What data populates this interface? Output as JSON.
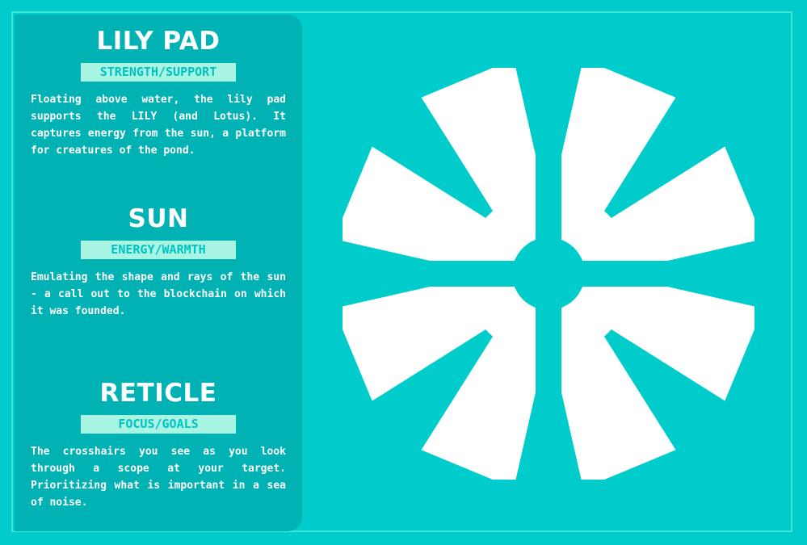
{
  "sections": [
    {
      "title": "LILY PAD",
      "tag": "STRENGTH/SUPPORT",
      "body": "Floating above water, the lily pad supports the LILY (and Lotus). It captures energy from the sun, a platform for creatures of the pond."
    },
    {
      "title": "SUN",
      "tag": "ENERGY/WARMTH",
      "body": "Emulating the shape and rays of the sun - a call out to the blockchain on which it was founded."
    },
    {
      "title": "RETICLE",
      "tag": "FOCUS/GOALS",
      "body": "The crosshairs you see as you look through a scope at your target. Prioritizing what is important in a sea of noise."
    }
  ],
  "emblem": {
    "icon": "sun-reticle-logo-icon"
  },
  "colors": {
    "background": "#00cccc",
    "panel": "#00b2b4",
    "tag_background": "#a9f5e3",
    "tag_text": "#00c2c2",
    "frame": "#3ee6d6",
    "emblem": "#ffffff"
  }
}
